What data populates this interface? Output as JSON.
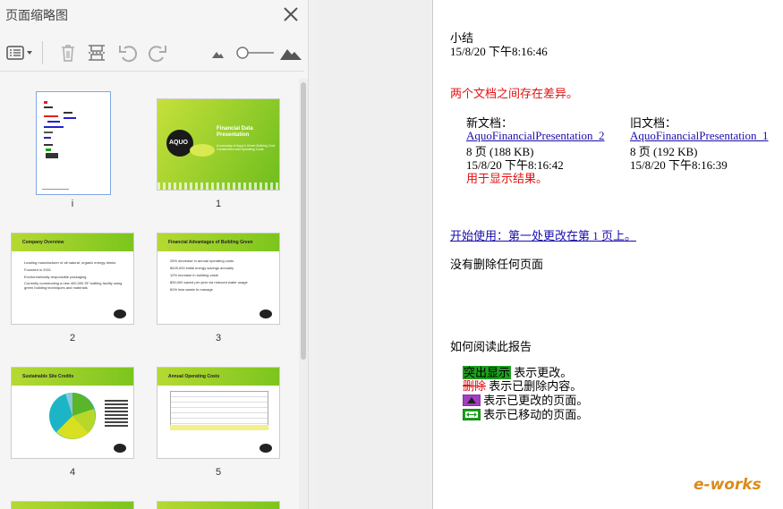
{
  "sidebar": {
    "title": "页面缩略图",
    "pages": [
      {
        "num": "i",
        "title": ""
      },
      {
        "num": "1",
        "title": "Financial Data Presentation"
      },
      {
        "num": "2",
        "title": "Company Overview"
      },
      {
        "num": "3",
        "title": "Financial Advantages of Building Green"
      },
      {
        "num": "4",
        "title": "Sustainable Site Credits"
      },
      {
        "num": "5",
        "title": "Annual Operating Costs"
      }
    ],
    "slide1": {
      "logo": "AQUO",
      "sub": "A summary of Aquo's Green Building Cost Construction and Operating Costs"
    },
    "slide2": {
      "bullets": [
        "Leading manufacturer of all natural, organic energy drinks",
        "Founded in 2001",
        "Environmentally responsible packaging",
        "Currently constructing a new 400,000 SF bottling facility using green building techniques and materials"
      ]
    },
    "slide3": {
      "bullets": [
        "26% decrease in annual operating costs",
        "$425,000 initial energy savings annually",
        "12% increase in building value",
        "$30,000 saved per year via reduced water usage",
        "60% less waste to manage"
      ]
    }
  },
  "report": {
    "heading": "小结",
    "timestamp": "15/8/20 下午8:16:46",
    "diff_notice": "两个文档之间存在差异。",
    "new_doc": {
      "label": "新文档：",
      "name": "AquoFinancialPresentation_2",
      "pages": "8 页 (188 KB)",
      "date": "15/8/20 下午8:16:42",
      "note": "用于显示结果。"
    },
    "old_doc": {
      "label": "旧文档：",
      "name": "AquoFinancialPresentation_1",
      "pages": "8 页 (192 KB)",
      "date": "15/8/20 下午8:16:39"
    },
    "start_link": "开始使用：第一处更改在第 1 页上。",
    "no_delete": "没有删除任何页面",
    "howto_title": "如何阅读此报告",
    "legend": [
      {
        "sample": "突出显示",
        "text": "表示更改。"
      },
      {
        "sample": "删除",
        "text": "表示已删除内容。"
      },
      {
        "sample": "",
        "text": "表示已更改的页面。"
      },
      {
        "sample": "",
        "text": "表示已移动的页面。"
      }
    ]
  },
  "watermark": {
    "main": "e-works",
    "sub": ""
  },
  "colors": {
    "accent_green": "#7cc51e",
    "highlight_green": "#1e9e1e",
    "red": "#e01010",
    "link": "#1a0dab",
    "changed_page": "#a040c0",
    "moved_page": "#1e9e1e"
  },
  "icons": [
    "view-options-icon",
    "delete-icon",
    "split-icon",
    "rotate-left-icon",
    "rotate-right-icon",
    "small-mountain-icon",
    "zoom-slider",
    "large-mountain-icon",
    "close-icon",
    "collapse-arrow-icon"
  ]
}
